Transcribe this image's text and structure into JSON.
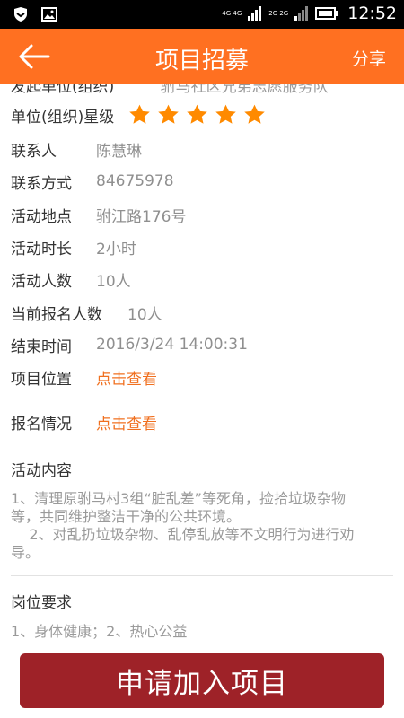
{
  "status_bar": {
    "net_tags_1": "4G 4G",
    "net_tags_2": "2G 2G",
    "time": "12:52"
  },
  "header": {
    "title": "项目招募",
    "share_label": "分享",
    "back_icon": "arrow-left-icon"
  },
  "details": {
    "partial_label": "发起单位(组织)",
    "partial_value": "驸马社区兄弟志愿服务队",
    "star_label": "单位(组织)星级",
    "star_rating": 5,
    "star_color": "#ff8a00",
    "contact_label": "联系人",
    "contact_value": "陈慧琳",
    "phone_label": "联系方式",
    "phone_value": "84675978",
    "location_label": "活动地点",
    "location_value": "驸江路176号",
    "duration_label": "活动时长",
    "duration_value": "2小时",
    "people_label": "活动人数",
    "people_value": "10人",
    "signed_label": "当前报名人数",
    "signed_value": "10人",
    "end_label": "结束时间",
    "end_value": "2016/3/24 14:00:31",
    "map_label": "项目位置",
    "map_link": "点击查看",
    "signup_label": "报名情况",
    "signup_link": "点击查看"
  },
  "activity": {
    "title": "活动内容",
    "line1": "1、清理原驸马村3组“脏乱差”等死角，捡拾垃圾杂物等，共同维护整洁干净的公共环境。",
    "line2": "    2、对乱扔垃圾杂物、乱停乱放等不文明行为进行劝导。"
  },
  "requirements": {
    "title": "岗位要求",
    "body": "1、身体健康；2、热心公益"
  },
  "action": {
    "join_label": "申请加入项目"
  },
  "colors": {
    "accent": "#ff7021",
    "link": "#f07020",
    "button": "#9e2228"
  }
}
